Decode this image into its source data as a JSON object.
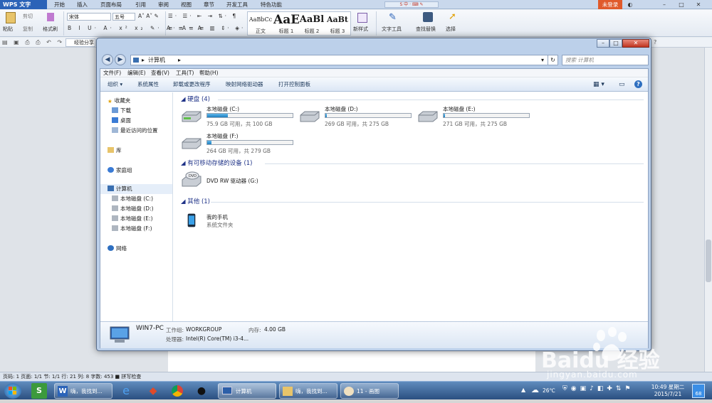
{
  "wps": {
    "logo": "WPS 文字",
    "menu": [
      "开始",
      "插入",
      "页面布局",
      "引用",
      "审阅",
      "视图",
      "章节",
      "开发工具",
      "特色功能"
    ],
    "login": "未登录",
    "ribbon": {
      "paste": "粘贴",
      "cut": "剪切",
      "copy": "复制",
      "format_painter": "格式刷",
      "font": "宋体",
      "size": "五号",
      "styles": [
        {
          "preview": "AaBbCc",
          "label": "正文"
        },
        {
          "preview": "AaE",
          "label": "标题 1"
        },
        {
          "preview": "AaBl",
          "label": "标题 2"
        },
        {
          "preview": "AaBt",
          "label": "标题 3"
        }
      ],
      "new_style": "新样式",
      "text_tools": "文字工具",
      "find_replace": "查找替换",
      "select": "选择"
    },
    "tab_title": "经验分享",
    "status": "页码: 1  页面: 1/1  节: 1/1  行: 21  列: 8  字数: 453  ■ 拼写检查"
  },
  "explorer": {
    "breadcrumb": "计算机",
    "search_placeholder": "搜索 计算机",
    "menu": [
      "文件(F)",
      "编辑(E)",
      "查看(V)",
      "工具(T)",
      "帮助(H)"
    ],
    "toolbar": [
      "组织 ▾",
      "系统属性",
      "卸载或更改程序",
      "映射网络驱动器",
      "打开控制面板"
    ],
    "nav": {
      "favorites": "收藏夹",
      "downloads": "下载",
      "desktop": "桌面",
      "recent": "最近访问的位置",
      "libraries": "库",
      "homegroup": "家庭组",
      "computer": "计算机",
      "drives": [
        "本地磁盘 (C:)",
        "本地磁盘 (D:)",
        "本地磁盘 (E:)",
        "本地磁盘 (F:)"
      ],
      "network": "网络"
    },
    "groups": {
      "hdd": "硬盘 (4)",
      "removable": "有可移动存储的设备 (1)",
      "other": "其他 (1)"
    },
    "drives": [
      {
        "name": "本地磁盘 (C:)",
        "info": "75.9 GB 可用，共 100 GB",
        "used_fraction": 0.24
      },
      {
        "name": "本地磁盘 (D:)",
        "info": "269 GB 可用，共 275 GB",
        "used_fraction": 0.02
      },
      {
        "name": "本地磁盘 (E:)",
        "info": "271 GB 可用，共 275 GB",
        "used_fraction": 0.01
      },
      {
        "name": "本地磁盘 (F:)",
        "info": "264 GB 可用，共 279 GB",
        "used_fraction": 0.05
      }
    ],
    "dvd": "DVD RW 驱动器 (G:)",
    "phone": {
      "name": "我的手机",
      "type": "系统文件夹"
    },
    "details": {
      "pc_name": "WIN7-PC",
      "workgroup_label": "工作组:",
      "workgroup": "WORKGROUP",
      "memory_label": "内存:",
      "memory": "4.00 GB",
      "cpu_label": "处理器:",
      "cpu": "Intel(R) Core(TM) i3-4..."
    }
  },
  "watermark": {
    "text": "Baidu 经验",
    "url": "jingyan.baidu.com"
  },
  "taskbar": {
    "items": [
      "嗨，我找到...",
      "计算机",
      "嗨，我找到...",
      "11 - 画图"
    ],
    "temperature": "26℃",
    "time": "10:49 星期二",
    "date": "2015/7/21",
    "badge": "68"
  }
}
